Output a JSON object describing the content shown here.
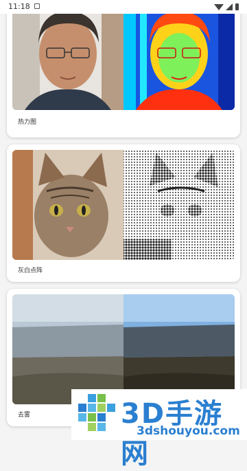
{
  "status_bar": {
    "time": "11:18"
  },
  "cards": [
    {
      "label": "热力图",
      "left_image": "portrait-original",
      "right_image": "portrait-heatmap"
    },
    {
      "label": "灰白点阵",
      "left_image": "cat-original",
      "right_image": "cat-halftone"
    },
    {
      "label": "去雾",
      "left_image": "landscape-hazy",
      "right_image": "landscape-dehazed"
    }
  ],
  "watermark": {
    "brand": "3D手游网",
    "url": "3dshouyou.com"
  }
}
